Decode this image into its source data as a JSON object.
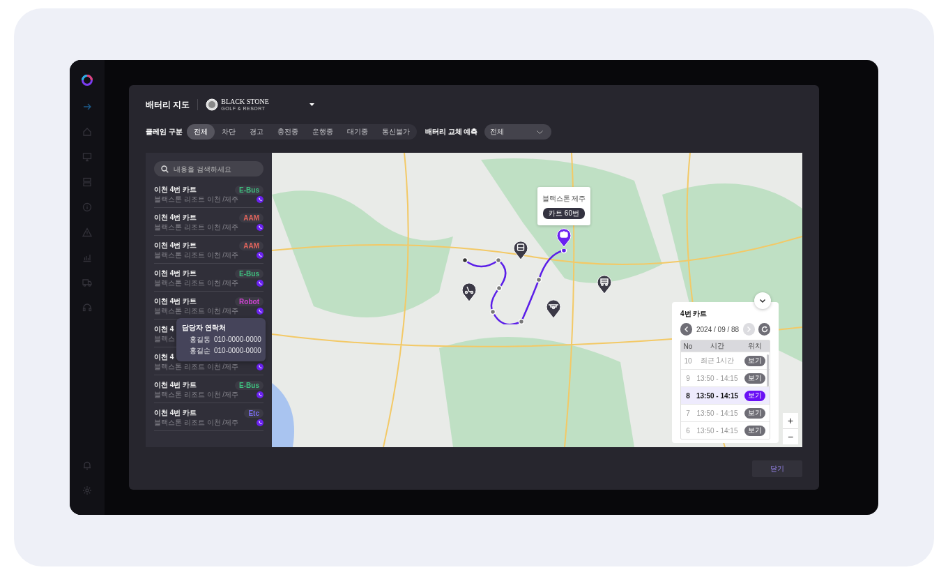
{
  "sidebar": {
    "items": [
      {
        "kind": "arrow",
        "selected": true
      },
      {
        "kind": "home",
        "selected": false
      },
      {
        "kind": "monitor",
        "selected": false
      },
      {
        "kind": "server",
        "selected": false
      },
      {
        "kind": "info",
        "selected": false
      },
      {
        "kind": "warning",
        "selected": false
      },
      {
        "kind": "chart",
        "selected": false
      },
      {
        "kind": "truck",
        "selected": false
      },
      {
        "kind": "headset",
        "selected": false
      }
    ],
    "bottom_items": [
      {
        "kind": "bell"
      },
      {
        "kind": "gear"
      }
    ]
  },
  "header": {
    "title": "배터리 지도",
    "brand": {
      "name": "BLACK STONE",
      "tagline": "GOLF & RESORT"
    }
  },
  "filters": {
    "label": "클레임 구분",
    "options": [
      {
        "label": "전체",
        "selected": true
      },
      {
        "label": "차단",
        "selected": false
      },
      {
        "label": "경고",
        "selected": false
      },
      {
        "label": "충전중",
        "selected": false
      },
      {
        "label": "운행중",
        "selected": false
      },
      {
        "label": "대기중",
        "selected": false
      },
      {
        "label": "통신불가",
        "selected": false
      }
    ],
    "prediction": {
      "label": "배터리 교체 예측",
      "value": "전체"
    }
  },
  "search": {
    "placeholder": "내용을 검색하세요"
  },
  "vehicles": [
    {
      "name": "이천 4번 카트",
      "location": "블랙스톤 리조트 이천 /제주",
      "tag": "E-Bus",
      "color": "#3fbf7f"
    },
    {
      "name": "이천 4번 카트",
      "location": "블랙스톤 리조트 이천 /제주",
      "tag": "AAM",
      "color": "#e0645c"
    },
    {
      "name": "이천 4번 카트",
      "location": "블랙스톤 리조트 이천 /제주",
      "tag": "AAM",
      "color": "#e0645c"
    },
    {
      "name": "이천 4번 카트",
      "location": "블랙스톤 리조트 이천 /제주",
      "tag": "E-Bus",
      "color": "#3fbf7f"
    },
    {
      "name": "이천 4번 카트",
      "location": "블랙스톤 리조트 이천 /제주",
      "tag": "Robot",
      "color": "#d243d6"
    },
    {
      "name": "이천 4",
      "location": "블랙스"
    },
    {
      "name": "이천 4",
      "location": "블랙스톤 리조트 이천 /제주"
    },
    {
      "name": "이천 4번 카트",
      "location": "블랙스톤 리조트 이천 /제주",
      "tag": "E-Bus",
      "color": "#3fbf7f"
    },
    {
      "name": "이천 4번 카트",
      "location": "블랙스톤 리조트 이천 /제주",
      "tag": "Etc",
      "color": "#7b6ef0"
    }
  ],
  "contact_tooltip": {
    "title": "담당자 연락처",
    "contacts": [
      {
        "name": "홍길동",
        "phone": "010-0000-0000"
      },
      {
        "name": "홍길순",
        "phone": "010-0000-0000"
      }
    ]
  },
  "map": {
    "popup": {
      "place": "블랙스톤 제주",
      "badge": "카트 60번"
    },
    "markers": [
      {
        "kind": "robot",
        "selected": true
      },
      {
        "kind": "bus",
        "selected": false
      },
      {
        "kind": "scooter",
        "selected": false
      },
      {
        "kind": "drone",
        "selected": false
      },
      {
        "kind": "cart",
        "selected": false
      }
    ]
  },
  "history": {
    "title": "4번 카트",
    "date": "2024 / 09 / 88",
    "prev_disabled": false,
    "next_disabled": true,
    "columns": [
      "No",
      "시간",
      "위치"
    ],
    "rows": [
      {
        "no": "10",
        "time": "최근 1시간",
        "action": "보기",
        "selected": false
      },
      {
        "no": "9",
        "time": "13:50 - 14:15",
        "action": "보기",
        "selected": false
      },
      {
        "no": "8",
        "time": "13:50 - 14:15",
        "action": "보기",
        "selected": true
      },
      {
        "no": "7",
        "time": "13:50 - 14:15",
        "action": "보기",
        "selected": false
      },
      {
        "no": "6",
        "time": "13:50 - 14:15",
        "action": "보기",
        "selected": false
      }
    ]
  },
  "zoom": {
    "in": "+",
    "out": "−"
  },
  "close_button": "닫기"
}
